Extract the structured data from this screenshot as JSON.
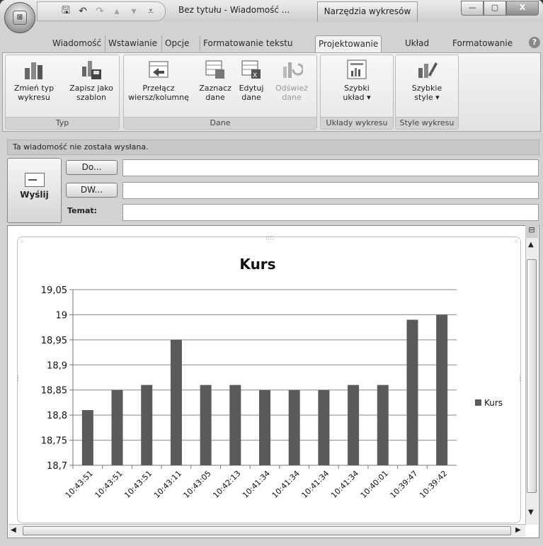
{
  "window": {
    "title": "Bez tytułu - Wiadomość ...",
    "context_tab_header": "Narzędzia wykresów",
    "buttons": {
      "minimize": "—",
      "maximize": "▢",
      "close": "X"
    }
  },
  "quick_access": {
    "save": "save-icon",
    "undo": "undo-icon",
    "redo": "redo-icon"
  },
  "tabs": [
    {
      "label": "Wiadomość"
    },
    {
      "label": "Wstawianie"
    },
    {
      "label": "Opcje"
    },
    {
      "label": "Formatowanie tekstu"
    },
    {
      "label": "Projektowanie",
      "active": true
    },
    {
      "label": "Układ"
    },
    {
      "label": "Formatowanie"
    }
  ],
  "ribbon": {
    "groups": [
      {
        "label": "Typ",
        "buttons": [
          {
            "l1": "Zmień typ",
            "l2": "wykresu"
          },
          {
            "l1": "Zapisz jako",
            "l2": "szablon"
          }
        ]
      },
      {
        "label": "Dane",
        "buttons": [
          {
            "l1": "Przełącz",
            "l2": "wiersz/kolumnę"
          },
          {
            "l1": "Zaznacz",
            "l2": "dane"
          },
          {
            "l1": "Edytuj",
            "l2": "dane"
          },
          {
            "l1": "Odśwież",
            "l2": "dane"
          }
        ]
      },
      {
        "label": "Układy wykresu",
        "buttons": [
          {
            "l1": "Szybki",
            "l2": "układ ▾"
          }
        ]
      },
      {
        "label": "Style wykresu",
        "buttons": [
          {
            "l1": "Szybkie",
            "l2": "style ▾"
          }
        ]
      }
    ]
  },
  "message": {
    "info_bar": "Ta wiadomość nie została wysłana.",
    "send_label": "Wyślij",
    "to_button": "Do...",
    "cc_button": "DW...",
    "subject_label": "Temat:",
    "to_value": "",
    "cc_value": "",
    "subject_value": ""
  },
  "chart_data": {
    "type": "bar",
    "title": "Kurs",
    "categories": [
      "10:43:51",
      "10:43:51",
      "10:43:51",
      "10:43:11",
      "10:43:05",
      "10:42:13",
      "10:41:34",
      "10:41:34",
      "10:41:34",
      "10:41:34",
      "10:40:01",
      "10:39:47",
      "10:39:42"
    ],
    "series": [
      {
        "name": "Kurs",
        "values": [
          18.81,
          18.85,
          18.86,
          18.95,
          18.86,
          18.86,
          18.85,
          18.85,
          18.85,
          18.86,
          18.86,
          18.99,
          19.0
        ]
      }
    ],
    "ylim": [
      18.7,
      19.05
    ],
    "yticks": [
      18.7,
      18.75,
      18.8,
      18.85,
      18.9,
      18.95,
      19.0,
      19.05
    ],
    "ytick_labels": [
      "18,7",
      "18,75",
      "18,8",
      "18,85",
      "18,9",
      "18,95",
      "19",
      "19,05"
    ],
    "grid": true,
    "legend": "right",
    "bar_color": "#5a5a5a"
  }
}
